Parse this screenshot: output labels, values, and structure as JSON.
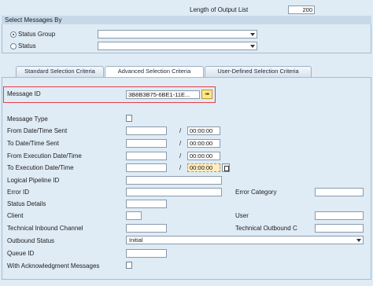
{
  "header": {
    "output_list_label": "Length of Output List",
    "output_list_value": "200"
  },
  "select_by": {
    "title": "Select Messages By",
    "status_group_label": "Status Group",
    "status_label": "Status",
    "status_group_value": "",
    "status_value": ""
  },
  "tabs": [
    {
      "label": "Standard Selection Criteria"
    },
    {
      "label": "Advanced Selection Criteria"
    },
    {
      "label": "User-Defined Selection Criteria"
    }
  ],
  "message_id": {
    "label": "Message ID",
    "value": "3B8B3B75-6BE1-11E..."
  },
  "fields": {
    "message_type": "Message Type",
    "from_sent": "From Date/Time Sent",
    "to_sent": "To Date/Time Sent",
    "from_exec": "From Execution Date/Time",
    "to_exec": "To Execution Date/Time",
    "logical_pipeline": "Logical Pipeline ID",
    "error_id": "Error ID",
    "error_category": "Error Category",
    "status_details": "Status Details",
    "client": "Client",
    "user": "User",
    "tech_inbound": "Technical Inbound Channel",
    "tech_outbound": "Technical Outbound C",
    "outbound_status": "Outbound Status",
    "outbound_status_value": "Initial",
    "queue_id": "Queue ID",
    "with_ack": "With Acknowledgment Messages"
  },
  "time_values": {
    "from_sent": "00:00:00",
    "to_sent": "00:00:00",
    "from_exec": "00:00:00",
    "to_exec": "00:00:00"
  },
  "slash": "/"
}
